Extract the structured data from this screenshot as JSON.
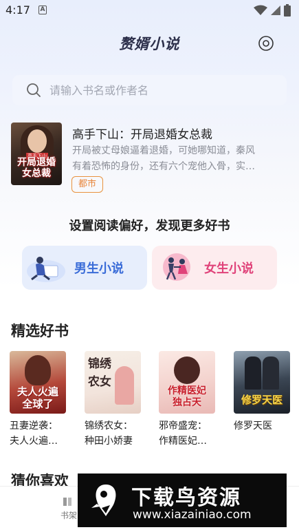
{
  "status_bar": {
    "time": "4:17",
    "notification_letter": "A"
  },
  "header": {
    "title": "赘婿小说",
    "settings_icon": "settings-ring-icon"
  },
  "search": {
    "placeholder": "请输入书名或作者名",
    "icon": "search-icon"
  },
  "featured": {
    "title": "高手下山：开局退婚女总裁",
    "description_line1": "开局被丈母娘逼着退婚，可她哪知道，秦风",
    "description_line2": "有着恐怖的身份，还有六个宠他入骨，实…",
    "tag": "都市",
    "cover_text_line1": "开局退婚",
    "cover_text_line2": "女总裁",
    "cover_banner": "高手下山"
  },
  "preference": {
    "title": "设置阅读偏好，发现更多好书",
    "male_label": "男生小说",
    "female_label": "女生小说"
  },
  "selected": {
    "title": "精选好书",
    "books": [
      {
        "title_line1": "丑妻逆袭：",
        "title_line2": "夫人火遍…",
        "cover_line1": "夫人火遍",
        "cover_line2": "全球了"
      },
      {
        "title_line1": "锦绣农女：",
        "title_line2": "种田小娇妻",
        "cover_line1": "锦绣",
        "cover_line2": "农女"
      },
      {
        "title_line1": "邪帝盛宠：",
        "title_line2": "作精医妃…",
        "cover_line1": "作精医妃",
        "cover_line2": "独占天"
      },
      {
        "title_line1": "修罗天医",
        "title_line2": "",
        "cover_line1": "修罗天医",
        "cover_line2": ""
      }
    ]
  },
  "guess": {
    "title": "猜你喜欢"
  },
  "bottom_nav": {
    "item1_label": "书架"
  },
  "watermark": {
    "text": "下载鸟资源",
    "url": "www.xiazainiao.com"
  },
  "colors": {
    "accent_male": "#3a6cd8",
    "accent_female": "#e0437a",
    "tag_orange": "#e8853a"
  }
}
